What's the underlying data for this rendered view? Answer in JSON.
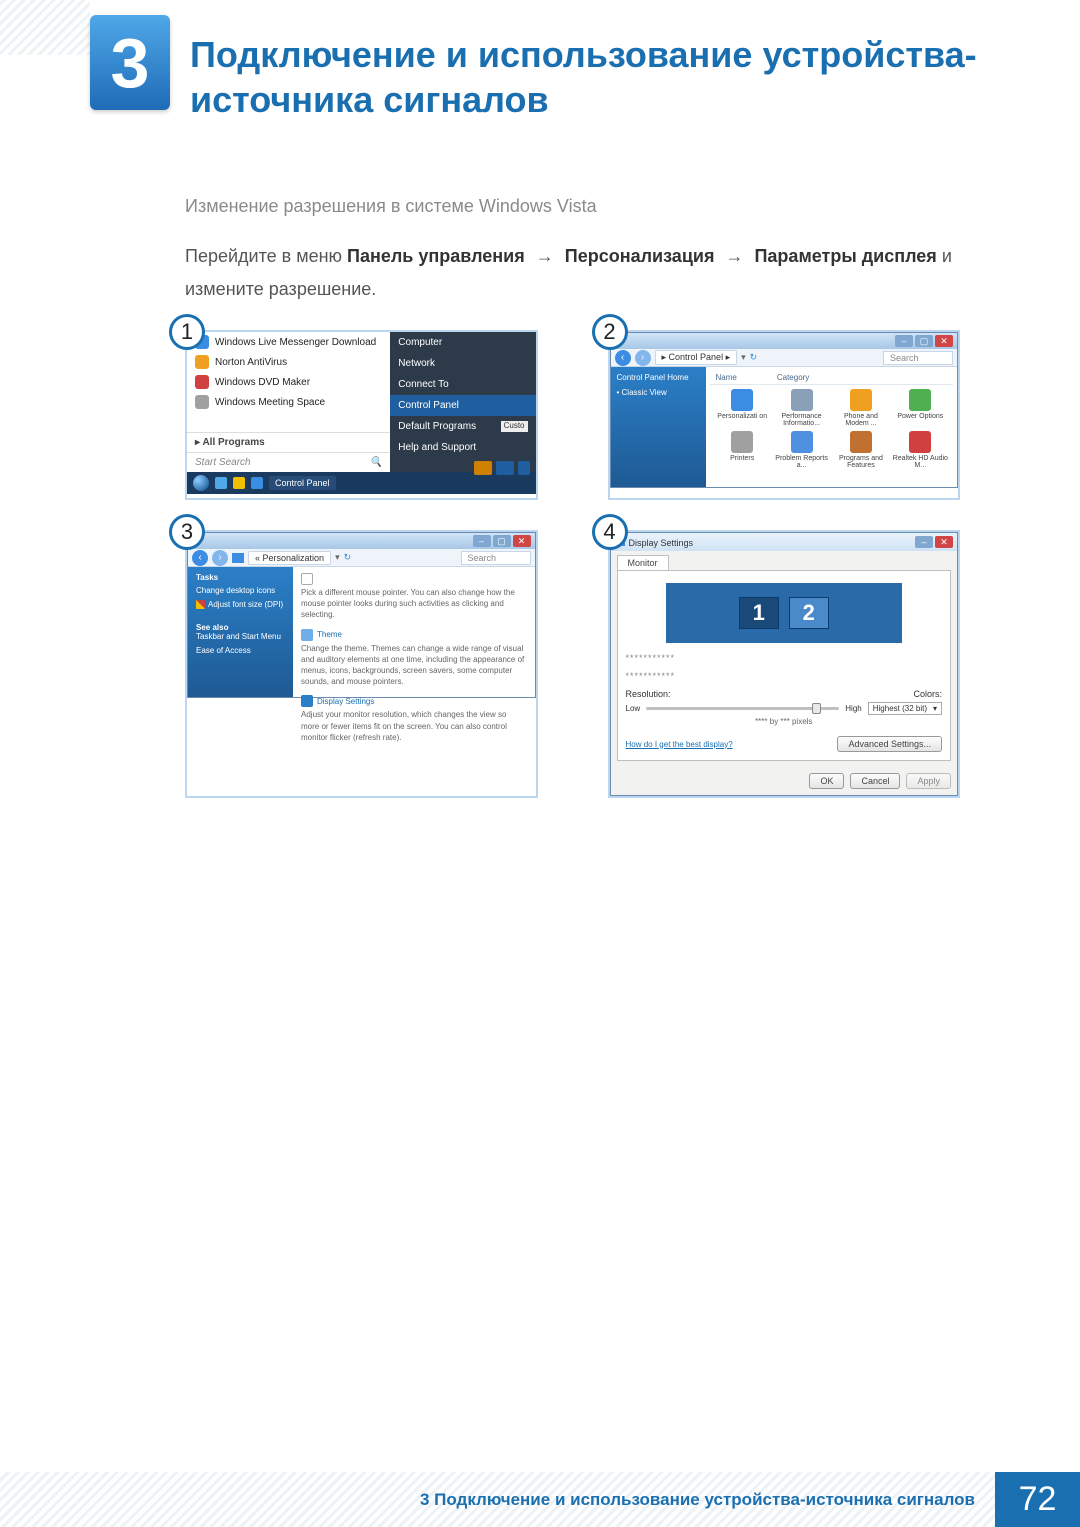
{
  "chapter": {
    "number": "3",
    "title": "Подключение и использование устройства-источника сигналов"
  },
  "section": {
    "subtitle": "Изменение разрешения в системе Windows Vista",
    "instr_pre": "Перейдите в меню ",
    "b1": "Панель управления",
    "arrow": "→",
    "b2": "Персонализация",
    "b3": "Параметры дисплея",
    "instr_post": " и измените разрешение."
  },
  "callouts": {
    "1": "1",
    "2": "2",
    "3": "3",
    "4": "4"
  },
  "shot1": {
    "left": [
      "Windows Live Messenger Download",
      "Norton AntiVirus",
      "Windows DVD Maker",
      "Windows Meeting Space"
    ],
    "all_programs": "All Programs",
    "search": "Start Search",
    "right": [
      "Computer",
      "Network",
      "Connect To",
      "Control Panel",
      "Default Programs",
      "Help and Support"
    ],
    "right_hi": "Control Panel",
    "taskbar_btn": "Control Panel",
    "custo": "Custo"
  },
  "shot2": {
    "title_btns": {
      "min": "–",
      "max": "▢",
      "close": "✕"
    },
    "crumb": "Control Panel",
    "search_ph": "Search",
    "side": {
      "home": "Control Panel Home",
      "classic": "Classic View"
    },
    "hdr": {
      "name": "Name",
      "cat": "Category"
    },
    "items": [
      "Personalizati on",
      "Performance Informatio...",
      "Phone and Modem ...",
      "Power Options",
      "Printers",
      "Problem Reports a...",
      "Programs and Features",
      "Realtek HD Audio M..."
    ],
    "colors": [
      "#3b8de3",
      "#8aa0b8",
      "#f0a020",
      "#4fb04f",
      "#a0a0a0",
      "#4f8fe0",
      "#c07030",
      "#d04040"
    ]
  },
  "shot3": {
    "crumb": "Personalization",
    "search_ph": "Search",
    "side": {
      "tasks": "Tasks",
      "l1": "Change desktop icons",
      "l2": "Adjust font size (DPI)",
      "see": "See also",
      "s1": "Taskbar and Start Menu",
      "s2": "Ease of Access"
    },
    "blocks": [
      {
        "hd": "",
        "bd": "Pick a different mouse pointer. You can also change how the mouse pointer looks during such activities as clicking and selecting."
      },
      {
        "hd": "Theme",
        "bd": "Change the theme. Themes can change a wide range of visual and auditory elements at one time, including the appearance of menus, icons, backgrounds, screen savers, some computer sounds, and mouse pointers."
      },
      {
        "hd": "Display Settings",
        "bd": "Adjust your monitor resolution, which changes the view so more or fewer items fit on the screen. You can also control monitor flicker (refresh rate)."
      }
    ]
  },
  "shot4": {
    "title": "Display Settings",
    "tab": "Monitor",
    "mon1": "1",
    "mon2": "2",
    "dots": "***********",
    "res_label": "Resolution:",
    "col_label": "Colors:",
    "low": "Low",
    "high": "High",
    "px": "**** by *** pixels",
    "color_sel": "Highest (32 bit)",
    "link": "How do I get the best display?",
    "adv": "Advanced Settings...",
    "ok": "OK",
    "cancel": "Cancel",
    "apply": "Apply"
  },
  "footer": {
    "text": "3 Подключение и использование устройства-источника сигналов",
    "page": "72"
  }
}
